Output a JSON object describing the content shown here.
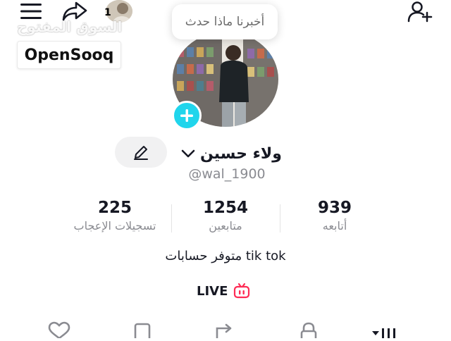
{
  "header": {
    "menu_icon": "menu-icon",
    "share_icon": "share-icon",
    "add_user_icon": "add-user-icon",
    "mini_count": "1"
  },
  "watermark": {
    "arabic": "السوق المفتوح",
    "brand": "OpenSooq"
  },
  "note_bubble": "أخبرنا ماذا حدث",
  "profile": {
    "display_name": "ولاء حسين",
    "username": "@wal_1900",
    "stats": [
      {
        "value": "939",
        "label": "أتابعه"
      },
      {
        "value": "1254",
        "label": "متابعين"
      },
      {
        "value": "225",
        "label": "تسجيلات الإعجاب"
      }
    ],
    "bio": "متوفر حسابات tik tok",
    "live_label": "LIVE"
  },
  "colors": {
    "accent_cyan": "#20d5ec",
    "live_pink": "#fe2c55",
    "text_primary": "#161823",
    "text_secondary": "#8a8b91"
  },
  "bottom_tabs": [
    "heart-icon",
    "bookmark-icon",
    "repost-icon",
    "lock-icon",
    "grid-icon"
  ]
}
